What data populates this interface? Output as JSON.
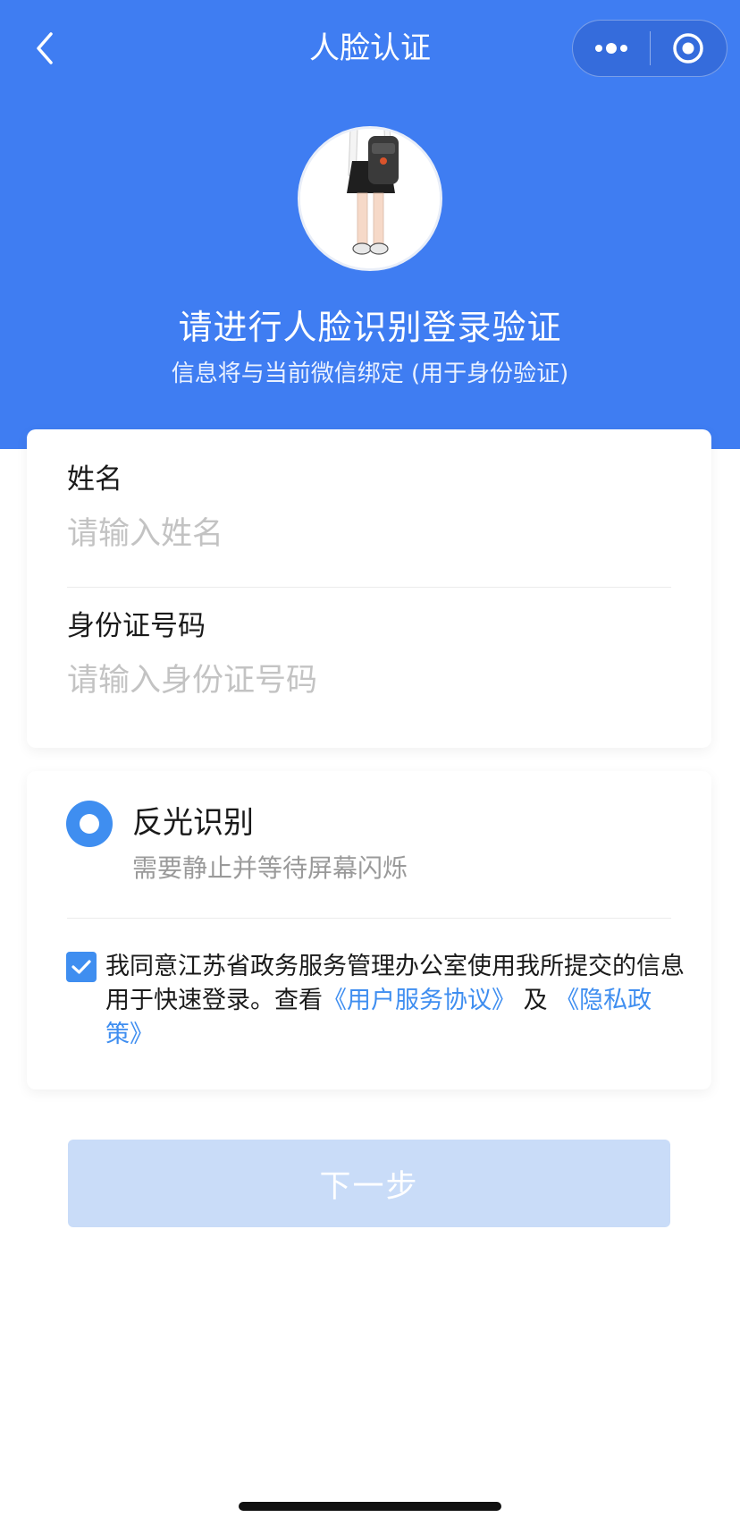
{
  "nav": {
    "title": "人脸认证",
    "back_icon": "chevron-left-icon",
    "more_icon": "more-dots-icon",
    "close_icon": "target-circle-icon"
  },
  "hero": {
    "title": "请进行人脸识别登录验证",
    "subtitle": "信息将与当前微信绑定 (用于身份验证)"
  },
  "form": {
    "name_label": "姓名",
    "name_placeholder": "请输入姓名",
    "name_value": "",
    "id_label": "身份证号码",
    "id_placeholder": "请输入身份证号码",
    "id_value": ""
  },
  "option": {
    "title": "反光识别",
    "description": "需要静止并等待屏幕闪烁",
    "selected": true
  },
  "agreement": {
    "checked": true,
    "text_prefix": "我同意江苏省政务服务管理办公室使用我所提交的信息用于快速登录。查看",
    "link_user": "《用户服务协议》",
    "text_and": "及",
    "link_privacy": "《隐私政策》"
  },
  "actions": {
    "next_label": "下一步"
  },
  "colors": {
    "header_blue": "#3f7df2",
    "accent": "#3f8ef0",
    "button_disabled": "#c9dcf8"
  }
}
